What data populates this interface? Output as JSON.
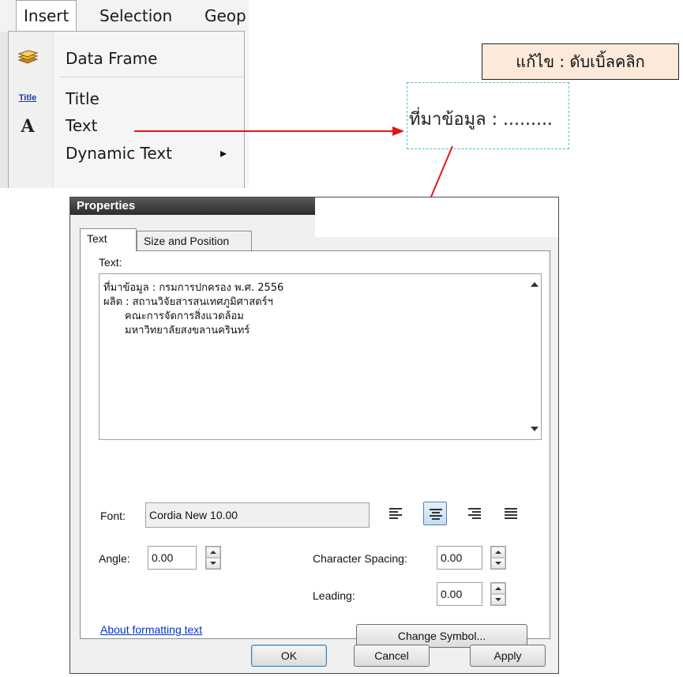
{
  "menu": {
    "bar": [
      "Insert",
      "Selection",
      "Geop"
    ],
    "items": [
      {
        "icon": "data-frame-icon",
        "label": "Data Frame"
      },
      {
        "icon": "title-icon",
        "icon_text": "Title",
        "label": "Title"
      },
      {
        "icon": "text-a-icon",
        "icon_text": "A",
        "label": "Text"
      },
      {
        "icon": "",
        "label": "Dynamic Text",
        "submenu_arrow": "▸"
      }
    ]
  },
  "annotation": {
    "note": "แก้ไข : ดับเบิ้ลคลิก",
    "text_element": "ที่มาข้อมูล : .........",
    "arrow_color": "#e0161b"
  },
  "dialog": {
    "title": "Properties",
    "tabs": [
      "Text",
      "Size and Position"
    ],
    "text_label": "Text:",
    "text_lines": [
      "ที่มาข้อมูล : กรมการปกครอง พ.ศ. 2556",
      "ผลิต : สถานวิจัยสารสนเทศภูมิศาสตร์ฯ",
      "คณะการจัดการสิ่งแวดล้อม",
      "มหาวิทยาลัยสงขลานครินทร์"
    ],
    "font_label": "Font:",
    "font_value": "Cordia New 10.00",
    "alignment": {
      "options": [
        "left",
        "center",
        "right",
        "justify"
      ],
      "selected": "center"
    },
    "angle_label": "Angle:",
    "angle_value": "0.00",
    "char_spacing_label": "Character Spacing:",
    "char_spacing_value": "0.00",
    "leading_label": "Leading:",
    "leading_value": "0.00",
    "about_link": "About formatting text",
    "change_symbol_button": "Change Symbol...",
    "ok_button": "OK",
    "cancel_button": "Cancel",
    "apply_button": "Apply"
  }
}
